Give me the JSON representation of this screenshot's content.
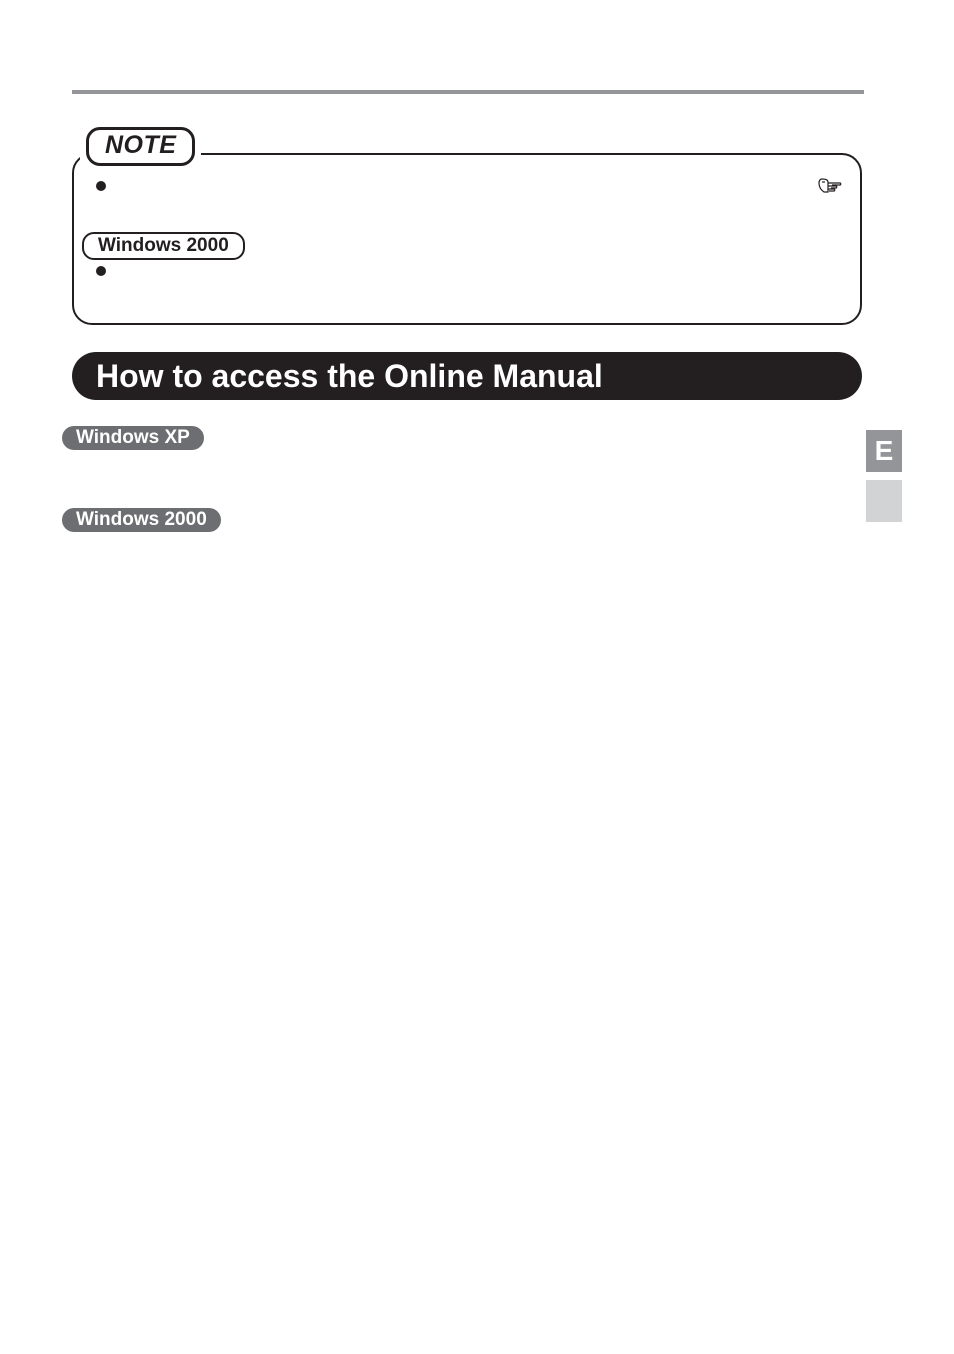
{
  "note": {
    "label": "NOTE",
    "os_pill": "Windows 2000"
  },
  "section": {
    "heading": "How to access the Online Manual",
    "pill_xp": "Windows XP",
    "pill_2000": "Windows 2000"
  },
  "side_tab": {
    "letter": "E"
  }
}
